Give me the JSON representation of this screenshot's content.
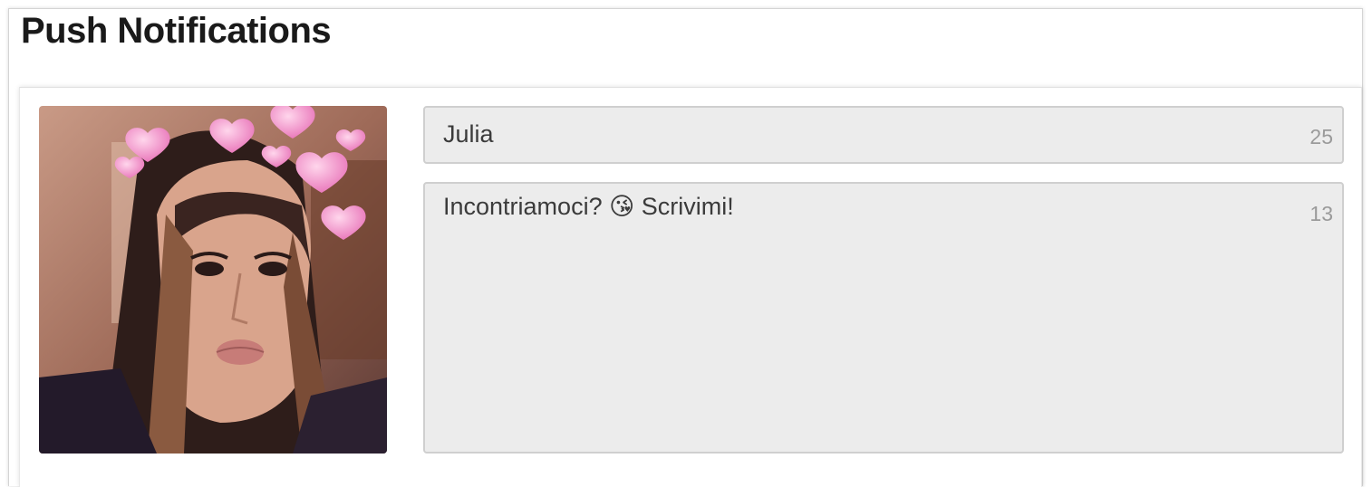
{
  "header": {
    "title": "Push Notifications"
  },
  "notification": {
    "avatar_icon": "profile-photo",
    "title_value": "Julia",
    "title_remaining": "25",
    "body_value": "Incontriamoci? 😘 Scrivimi!",
    "body_remaining": "13"
  },
  "colors": {
    "field_background": "#ececec",
    "field_border": "#cfcfcf",
    "counter_text": "#9a9a9a",
    "title_text": "#1a1a1a"
  }
}
